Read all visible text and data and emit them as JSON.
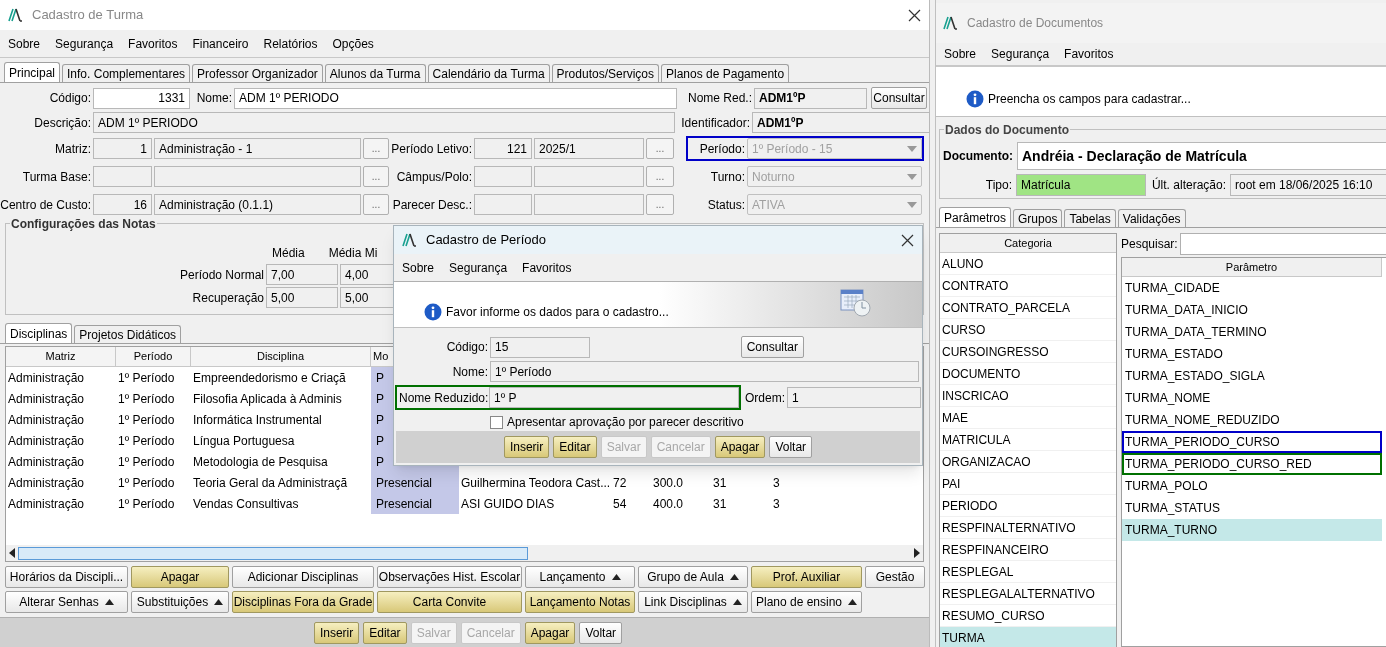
{
  "turma_window": {
    "title": "Cadastro de Turma",
    "menu": [
      "Sobre",
      "Segurança",
      "Favoritos",
      "Financeiro",
      "Relatórios",
      "Opções"
    ],
    "tabs": [
      {
        "label": "Principal",
        "selected": true
      },
      {
        "label": "Info. Complementares",
        "selected": false
      },
      {
        "label": "Professor Organizador",
        "selected": false
      },
      {
        "label": "Alunos da Turma",
        "selected": false
      },
      {
        "label": "Calendário da Turma",
        "selected": false
      },
      {
        "label": "Produtos/Serviços",
        "selected": false
      },
      {
        "label": "Planos de Pagamento",
        "selected": false
      }
    ],
    "form": {
      "codigo": {
        "label": "Código:",
        "value": "1331"
      },
      "nome": {
        "label": "Nome:",
        "value": "ADM 1º PERIODO"
      },
      "nome_red": {
        "label": "Nome Red.:",
        "value": "ADM1ºP"
      },
      "consultar": "Consultar",
      "descricao": {
        "label": "Descrição:",
        "value": "ADM 1º PERIODO"
      },
      "identificador": {
        "label": "Identificador:",
        "value": "ADM1ºP"
      },
      "lookups": [
        {
          "label": "Matriz:",
          "code": "1",
          "name": "Administração - 1",
          "button": "...",
          "label2": "Período Letivo:",
          "code2": "121",
          "name2": "2025/1",
          "button2": "..."
        },
        {
          "label": "Turma Base:",
          "button": "...",
          "label2": "Câmpus/Polo:",
          "button2": "..."
        },
        {
          "label": "Centro de Custo:",
          "code": "16",
          "name": "Administração (0.1.1)",
          "button": "...",
          "label2": "Parecer Desc.:",
          "button2": "..."
        }
      ],
      "selects": [
        {
          "label": "Período:",
          "value": "1º Período - 15",
          "disabled": true,
          "color": "#0000c8"
        },
        {
          "label": "Turno:",
          "value": "Noturno",
          "disabled": true
        },
        {
          "label": "Status:",
          "value": "ATIVA",
          "disabled": true
        }
      ]
    },
    "notas": {
      "title": "Configurações das Notas",
      "columns": [
        "Média",
        "Média Mi"
      ],
      "rows": [
        {
          "label": "Período Normal",
          "values": [
            "7,00",
            "4,00"
          ]
        },
        {
          "label": "Recuperação",
          "values": [
            "5,00",
            "5,00"
          ]
        }
      ]
    },
    "lower_tabs": [
      {
        "label": "Disciplinas",
        "selected": true
      },
      {
        "label": "Projetos Didáticos",
        "selected": false
      }
    ],
    "table": {
      "columns": [
        "Matriz",
        "Período",
        "Disciplina",
        "Mo"
      ],
      "rows": [
        [
          "Administração",
          "1º Período",
          "Empreendedorismo e Criaçã",
          "P"
        ],
        [
          "Administração",
          "1º Período",
          "Filosofia Aplicada à Adminis",
          "P"
        ],
        [
          "Administração",
          "1º Período",
          "Informática Instrumental",
          "P"
        ],
        [
          "Administração",
          "1º Período",
          "Língua Portuguesa",
          "P"
        ],
        [
          "Administração",
          "1º Período",
          "Metodologia de Pesquisa",
          "P"
        ],
        [
          "Administração",
          "1º Período",
          "Teoria Geral da Administraçã",
          "Presencial",
          "Guilhermina Teodora Cast...",
          "72",
          "300.0",
          "31",
          "3"
        ],
        [
          "Administração",
          "1º Período",
          "Vendas Consultivas",
          "Presencial",
          "ASI GUIDO DIAS",
          "54",
          "400.0",
          "31",
          "3"
        ]
      ]
    },
    "action_buttons": [
      {
        "label": "Horários da Discipli...",
        "highlighted": false,
        "dropdown": false
      },
      {
        "label": "Apagar",
        "highlighted": true,
        "dropdown": false
      },
      {
        "label": "Adicionar Disciplinas",
        "highlighted": false,
        "dropdown": false
      },
      {
        "label": "Observações Hist. Escolar",
        "highlighted": false,
        "dropdown": false
      },
      {
        "label": "Lançamento",
        "highlighted": false,
        "dropdown": true
      },
      {
        "label": "Grupo de Aula",
        "highlighted": false,
        "dropdown": true
      },
      {
        "label": "Prof. Auxiliar",
        "highlighted": true,
        "dropdown": false
      },
      {
        "label": "Gestão",
        "highlighted": false,
        "dropdown": false
      },
      {
        "label": "Alterar Senhas",
        "highlighted": false,
        "dropdown": true
      },
      {
        "label": "Substituições",
        "highlighted": false,
        "dropdown": true
      },
      {
        "label": "Disciplinas Fora da Grade",
        "highlighted": true,
        "dropdown": false
      },
      {
        "label": "Carta Convite",
        "highlighted": true,
        "dropdown": false
      },
      {
        "label": "Lançamento Notas",
        "highlighted": true,
        "dropdown": false
      },
      {
        "label": "Link Disciplinas",
        "highlighted": false,
        "dropdown": true
      },
      {
        "label": "Plano de ensino",
        "highlighted": false,
        "dropdown": true
      }
    ],
    "footer_buttons": [
      {
        "label": "Inserir",
        "highlighted": true,
        "disabled": false
      },
      {
        "label": "Editar",
        "highlighted": true,
        "disabled": false
      },
      {
        "label": "Salvar",
        "highlighted": false,
        "disabled": true
      },
      {
        "label": "Cancelar",
        "highlighted": false,
        "disabled": true
      },
      {
        "label": "Apagar",
        "highlighted": true,
        "disabled": false
      },
      {
        "label": "Voltar",
        "highlighted": false,
        "disabled": false
      }
    ]
  },
  "periodo_dialog": {
    "title": "Cadastro de Período",
    "menu": [
      "Sobre",
      "Segurança",
      "Favoritos"
    ],
    "message": "Favor informe os dados para o cadastro...",
    "codigo": {
      "label": "Código:",
      "value": "15"
    },
    "consultar": "Consultar",
    "nome": {
      "label": "Nome:",
      "value": "1º Período"
    },
    "nome_reduzido": {
      "label": "Nome Reduzido:",
      "value": "1º P",
      "color": "#007000"
    },
    "ordem": {
      "label": "Ordem:",
      "value": "1"
    },
    "checkbox": {
      "label": "Apresentar aprovação por parecer descritivo",
      "checked": false
    },
    "buttons": [
      {
        "label": "Inserir",
        "highlighted": true,
        "disabled": false
      },
      {
        "label": "Editar",
        "highlighted": true,
        "disabled": false
      },
      {
        "label": "Salvar",
        "highlighted": false,
        "disabled": true
      },
      {
        "label": "Cancelar",
        "highlighted": false,
        "disabled": true
      },
      {
        "label": "Apagar",
        "highlighted": true,
        "disabled": false
      },
      {
        "label": "Voltar",
        "highlighted": false,
        "disabled": false
      }
    ]
  },
  "documentos_window": {
    "title": "Cadastro de Documentos",
    "menu": [
      "Sobre",
      "Segurança",
      "Favoritos"
    ],
    "message": "Preencha os campos para cadastrar...",
    "group_title": "Dados do Documento",
    "documento": {
      "label": "Documento:",
      "value": "Andréia - Declaração de Matrícula"
    },
    "tipo": {
      "label": "Tipo:",
      "value": "Matrícula"
    },
    "alteracao": {
      "label": "Últ. alteração:",
      "value": "root em 18/06/2025 16:10"
    },
    "tabs": [
      {
        "label": "Parâmetros",
        "selected": true
      },
      {
        "label": "Grupos",
        "selected": false
      },
      {
        "label": "Tabelas",
        "selected": false
      },
      {
        "label": "Validações",
        "selected": false
      }
    ],
    "category_header": "Categoria",
    "categories": [
      {
        "label": "ALUNO",
        "selected": false
      },
      {
        "label": "CONTRATO",
        "selected": false
      },
      {
        "label": "CONTRATO_PARCELA",
        "selected": false
      },
      {
        "label": "CURSO",
        "selected": false
      },
      {
        "label": "CURSOINGRESSO",
        "selected": false
      },
      {
        "label": "DOCUMENTO",
        "selected": false
      },
      {
        "label": "INSCRICAO",
        "selected": false
      },
      {
        "label": "MAE",
        "selected": false
      },
      {
        "label": "MATRICULA",
        "selected": false
      },
      {
        "label": "ORGANIZACAO",
        "selected": false
      },
      {
        "label": "PAI",
        "selected": false
      },
      {
        "label": "PERIODO",
        "selected": false
      },
      {
        "label": "RESPFINALTERNATIVO",
        "selected": false
      },
      {
        "label": "RESPFINANCEIRO",
        "selected": false
      },
      {
        "label": "RESPLEGAL",
        "selected": false
      },
      {
        "label": "RESPLEGALALTERNATIVO",
        "selected": false
      },
      {
        "label": "RESUMO_CURSO",
        "selected": false
      },
      {
        "label": "TURMA",
        "selected": true
      }
    ],
    "search_label": "Pesquisar:",
    "parameter_header": "Parâmetro",
    "parameters": [
      {
        "label": "TURMA_CIDADE",
        "selected": false
      },
      {
        "label": "TURMA_DATA_INICIO",
        "selected": false
      },
      {
        "label": "TURMA_DATA_TERMINO",
        "selected": false
      },
      {
        "label": "TURMA_ESTADO",
        "selected": false
      },
      {
        "label": "TURMA_ESTADO_SIGLA",
        "selected": false
      },
      {
        "label": "TURMA_NOME",
        "selected": false
      },
      {
        "label": "TURMA_NOME_REDUZIDO",
        "selected": false
      },
      {
        "label": "TURMA_PERIODO_CURSO",
        "selected": false,
        "color": "#0000c8"
      },
      {
        "label": "TURMA_PERIODO_CURSO_RED",
        "selected": false,
        "color": "#007000"
      },
      {
        "label": "TURMA_POLO",
        "selected": false
      },
      {
        "label": "TURMA_STATUS",
        "selected": false
      },
      {
        "label": "TURMA_TURNO",
        "selected": true
      }
    ]
  }
}
